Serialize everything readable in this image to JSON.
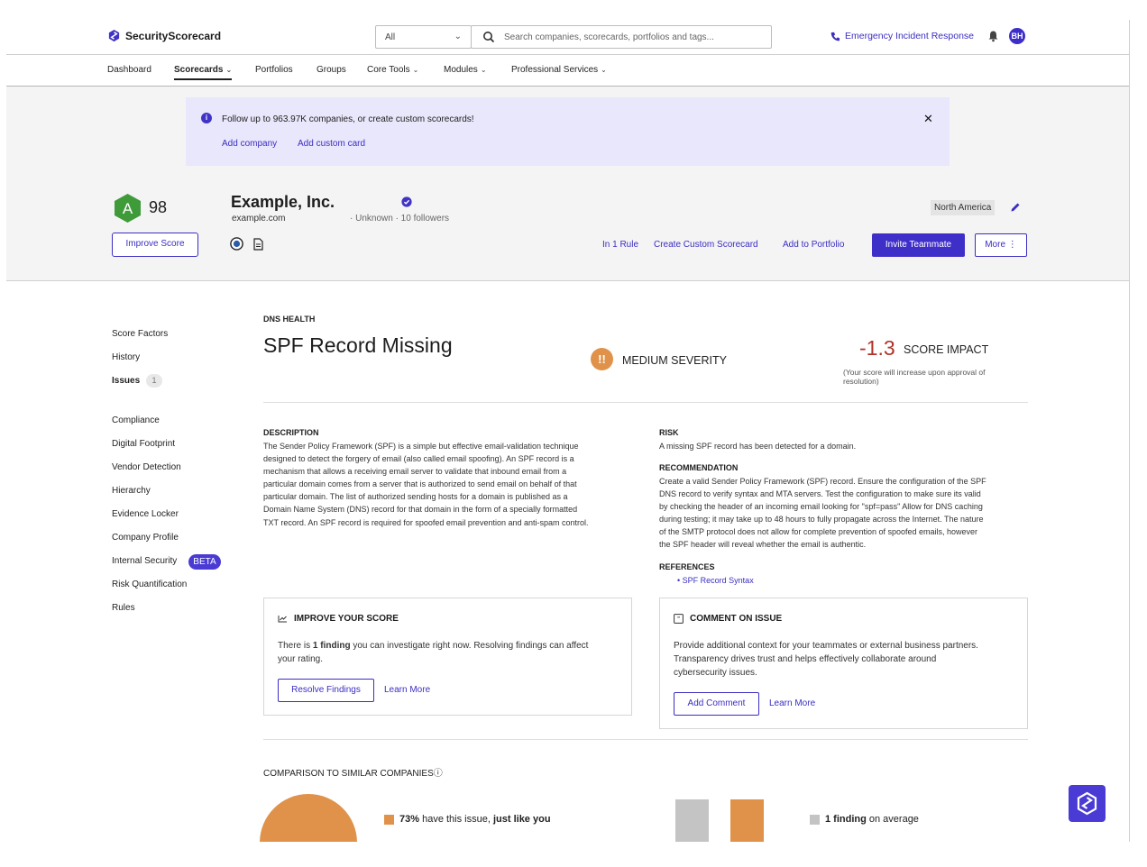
{
  "app": {
    "logo_text": "SecurityScorecard"
  },
  "top": {
    "scope_value": "All",
    "search_placeholder": "Search companies, scorecards, portfolios and tags...",
    "emergency_label": "Emergency Incident Response",
    "avatar_initials": "BH"
  },
  "nav": {
    "items": [
      "Dashboard",
      "Scorecards",
      "Portfolios",
      "Groups",
      "Core Tools",
      "Modules",
      "Professional Services"
    ],
    "active": "Scorecards"
  },
  "banner": {
    "message": "Follow up to 963.97K companies, or create custom scorecards!",
    "add_company": "Add company",
    "add_custom_card": "Add custom card"
  },
  "company": {
    "grade": "A",
    "score": "98",
    "name": "Example, Inc.",
    "domain": "example.com",
    "meta": "· Unknown · 10 followers",
    "region": "North America",
    "improve_score": "Improve Score",
    "in_rule": "In 1 Rule",
    "create_custom": "Create Custom Scorecard",
    "add_portfolio": "Add to Portfolio",
    "invite": "Invite Teammate",
    "more": "More ⋮"
  },
  "sidebar": {
    "group1": [
      "Score Factors",
      "History",
      "Issues"
    ],
    "issues_count": "1",
    "group2": [
      "Compliance",
      "Digital Footprint",
      "Vendor Detection",
      "Hierarchy",
      "Evidence Locker",
      "Company Profile",
      "Internal Security",
      "Risk Quantification",
      "Rules"
    ],
    "beta": "BETA"
  },
  "issue": {
    "category": "DNS HEALTH",
    "title": "SPF Record Missing",
    "severity": "MEDIUM SEVERITY",
    "impact_value": "-1.3",
    "impact_label": "SCORE IMPACT",
    "impact_note": "(Your score will increase upon approval of resolution)",
    "description_h": "DESCRIPTION",
    "description_lines": [
      "The Sender Policy Framework (SPF) is a simple but effective email-validation technique",
      "designed to detect the forgery of email (also called email spoofing). An SPF record is a",
      "mechanism that allows a receiving email server to validate that inbound email from a",
      "particular domain comes from a server that is authorized to send email on behalf of that",
      "particular domain. The list of authorized sending hosts for a domain is published as a",
      "Domain Name System (DNS) record for that domain in the form of a specially formatted",
      "TXT record. An SPF record is required for spoofed email prevention and anti-spam control."
    ],
    "risk_h": "RISK",
    "risk": "A missing SPF record has been detected for a domain.",
    "recommendation_h": "RECOMMENDATION",
    "recommendation_lines": [
      "Create a valid Sender Policy Framework (SPF) record. Ensure the configuration of the SPF",
      "DNS record to verify syntax and MTA servers. Test the configuration to make sure its valid",
      "by checking the header of an incoming email looking for \"spf=pass\" Allow for DNS caching",
      "during testing; it may take up to 48 hours to fully propagate across the Internet. The nature",
      "of the SMTP protocol does not allow for complete prevention of spoofed emails, however",
      "the SPF header will reveal whether the email is authentic."
    ],
    "references_h": "REFERENCES",
    "reference_link": "SPF Record Syntax"
  },
  "improve_card": {
    "title": "IMPROVE YOUR SCORE",
    "text_pre": "There is ",
    "text_bold": "1 finding",
    "text_post": " you can investigate right now. Resolving findings can affect",
    "text_line2": "your rating.",
    "button": "Resolve Findings",
    "link": "Learn More"
  },
  "comment_card": {
    "title": "COMMENT ON ISSUE",
    "lines": [
      "Provide additional context for your teammates or external business partners.",
      "Transparency drives trust and helps effectively collaborate around",
      "cybersecurity issues."
    ],
    "button": "Add Comment",
    "link": "Learn More"
  },
  "comparison": {
    "title": "COMPARISON TO SIMILAR COMPANIES",
    "pct_bold": "73%",
    "pct_mid": " have this issue, ",
    "pct_tail": "just like you",
    "avg_bold": "1 finding",
    "avg_tail": " on average"
  },
  "colors": {
    "accent": "#3f2fc9",
    "severity": "#e0924a",
    "impact": "#b03327",
    "grade": "#3f9a3a",
    "banner": "#e9e7fb"
  },
  "icons": [
    "logo-icon",
    "chevron-down-icon",
    "search-icon",
    "phone-icon",
    "bell-icon",
    "info-icon",
    "close-icon",
    "verified-icon",
    "badge-circle-icon",
    "document-icon",
    "pencil-icon",
    "severity-icon",
    "trend-icon",
    "comment-icon",
    "help-icon",
    "fab-logo-icon"
  ]
}
